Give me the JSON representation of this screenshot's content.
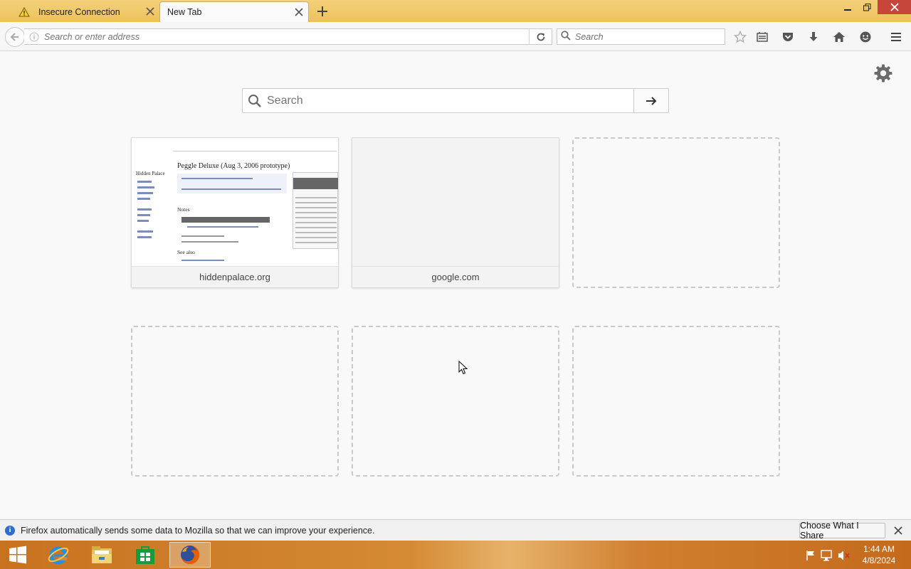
{
  "browser": {
    "tabs": [
      {
        "label": "Insecure Connection",
        "icon": "warning-icon",
        "active": false
      },
      {
        "label": "New Tab",
        "active": true
      }
    ],
    "urlbar": {
      "placeholder": "Search or enter address"
    },
    "searchbar": {
      "placeholder": "Search"
    },
    "toolbar_icons": [
      "bookmark-star-icon",
      "reading-list-icon",
      "pocket-icon",
      "download-icon",
      "home-icon",
      "hello-chat-icon",
      "menu-icon"
    ]
  },
  "newtab": {
    "search": {
      "placeholder": "Search"
    },
    "tiles": [
      {
        "caption": "hiddenpalace.org",
        "state": "filled"
      },
      {
        "caption": "google.com",
        "state": "filled"
      },
      {
        "caption": "",
        "state": "empty"
      },
      {
        "caption": "",
        "state": "empty"
      },
      {
        "caption": "",
        "state": "empty"
      },
      {
        "caption": "",
        "state": "empty"
      }
    ],
    "thumbnail": {
      "heading": "Peggle Deluxe (Aug 3, 2006 prototype)",
      "site_name": "Hidden Palace",
      "notes_heading": "Notes",
      "see_also_heading": "See also",
      "infobox_title": "Peggle Deluxe (Aug 3, 2006 prototype)"
    }
  },
  "notification": {
    "text": "Firefox automatically sends some data to Mozilla so that we can improve your experience.",
    "button": "Choose What I Share"
  },
  "taskbar": {
    "apps": [
      "internet-explorer-icon",
      "file-explorer-icon",
      "store-icon",
      "firefox-icon"
    ],
    "clock": {
      "time": "1:44 AM",
      "date": "4/8/2024"
    }
  },
  "colors": {
    "titlebar": "#ecc25c",
    "close_button": "#c7463b",
    "taskbar": "#d08030",
    "info_blue": "#2a6fd0"
  }
}
